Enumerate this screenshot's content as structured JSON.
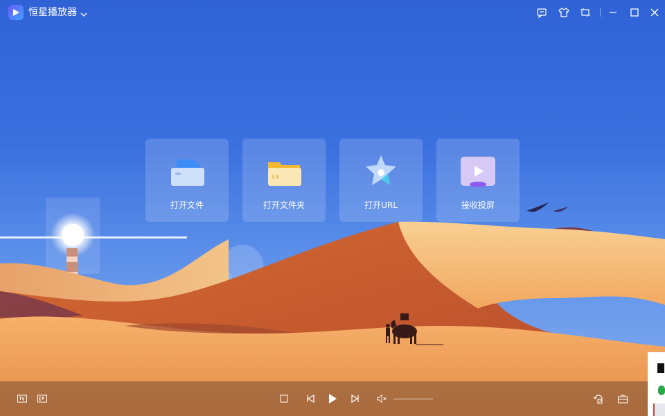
{
  "app": {
    "title": "恒星播放器"
  },
  "titlebar": {
    "icons": [
      "chevron-down-icon",
      "feedback-icon",
      "skin-icon",
      "mini-mode-icon",
      "minimize-icon",
      "maximize-icon",
      "close-icon"
    ]
  },
  "actions": [
    {
      "label": "打开文件",
      "icon": "open-file-icon"
    },
    {
      "label": "打开文件夹",
      "icon": "open-folder-icon"
    },
    {
      "label": "打开URL",
      "icon": "open-url-icon"
    },
    {
      "label": "接收投屏",
      "icon": "receive-cast-icon"
    }
  ],
  "bottombar": {
    "left_icons": [
      "tv-icon",
      "pc-cast-icon"
    ],
    "controls": [
      "stop-icon",
      "previous-icon",
      "play-icon",
      "next-icon",
      "mute-icon"
    ],
    "right_icons": [
      "rotate-icon",
      "toolbox-icon"
    ]
  },
  "colors": {
    "sky_top": "#2f62d6",
    "sky_bottom": "#8bb2f0",
    "dune_light": "#f3b572",
    "dune_dark": "#c3592c",
    "dune_shadow": "#8a3a3a",
    "accent": "#3fa0ff"
  }
}
